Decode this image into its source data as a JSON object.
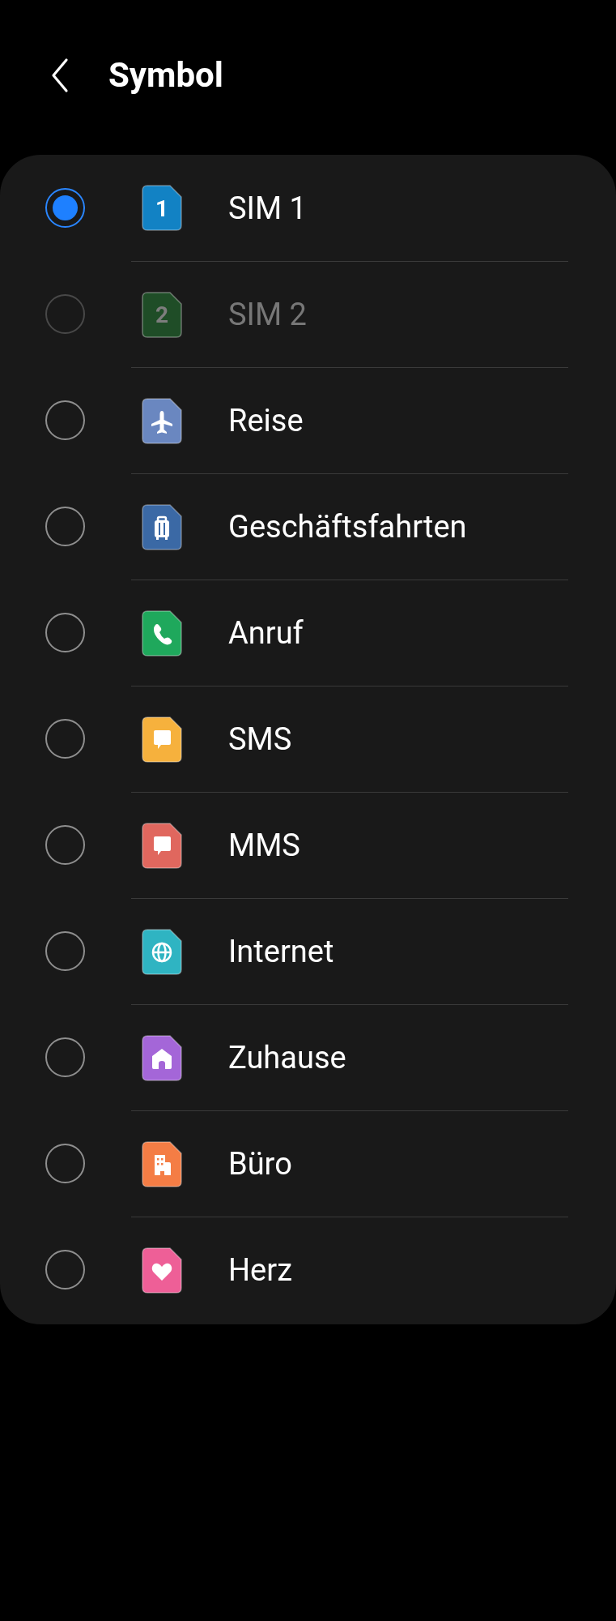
{
  "header": {
    "title": "Symbol"
  },
  "items": [
    {
      "label": "SIM 1",
      "kind": "sim",
      "number": "1",
      "color": "#1282c4",
      "selected": true,
      "disabled": false
    },
    {
      "label": "SIM 2",
      "kind": "sim",
      "number": "2",
      "color": "#1f4d27",
      "selected": false,
      "disabled": true
    },
    {
      "label": "Reise",
      "kind": "plane",
      "color": "#6a87c0",
      "selected": false,
      "disabled": false
    },
    {
      "label": "Geschäftsfahrten",
      "kind": "suitcase",
      "color": "#3b69a5",
      "selected": false,
      "disabled": false
    },
    {
      "label": "Anruf",
      "kind": "phone",
      "color": "#1fa85c",
      "selected": false,
      "disabled": false
    },
    {
      "label": "SMS",
      "kind": "message",
      "color": "#f6b13d",
      "selected": false,
      "disabled": false
    },
    {
      "label": "MMS",
      "kind": "message",
      "color": "#e0675e",
      "selected": false,
      "disabled": false
    },
    {
      "label": "Internet",
      "kind": "globe",
      "color": "#2fb4c2",
      "selected": false,
      "disabled": false
    },
    {
      "label": "Zuhause",
      "kind": "home",
      "color": "#a466d8",
      "selected": false,
      "disabled": false
    },
    {
      "label": "Büro",
      "kind": "building",
      "color": "#f47d45",
      "selected": false,
      "disabled": false
    },
    {
      "label": "Herz",
      "kind": "heart",
      "color": "#ee5f97",
      "selected": false,
      "disabled": false
    }
  ]
}
